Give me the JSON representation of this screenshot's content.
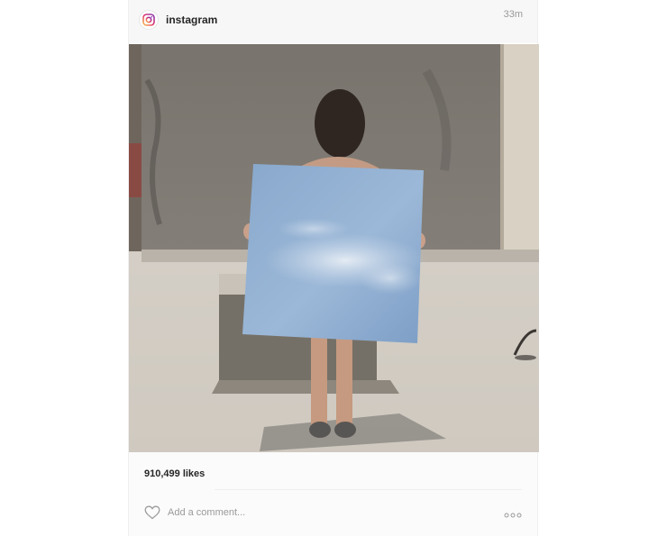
{
  "post": {
    "username": "instagram",
    "time": "33m",
    "likes": "910,499 likes",
    "comment_placeholder": "Add a comment..."
  },
  "icons": {
    "avatar": "instagram-logo-icon",
    "like": "heart-icon",
    "more": "ellipsis-icon"
  },
  "colors": {
    "header_bg": "#f7f7f7",
    "text": "#262626",
    "muted": "#9a9a9a",
    "sky_panel": "#8eafd2"
  }
}
